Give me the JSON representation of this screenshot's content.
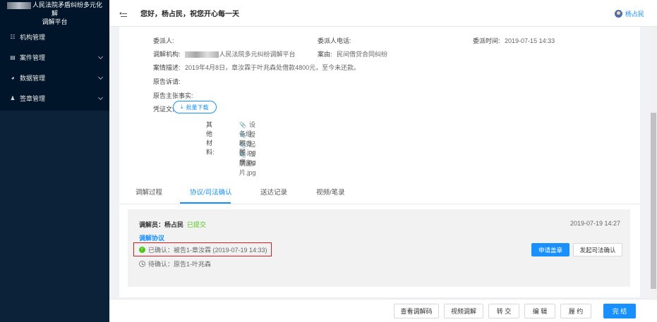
{
  "brand": {
    "title_line1": "人民法院矛盾纠纷多元化解",
    "title_line2": "调解平台"
  },
  "sidebar": {
    "items": [
      {
        "label": "机构管理",
        "icon": "sitemap-icon",
        "expandable": false
      },
      {
        "label": "案件管理",
        "icon": "document-icon",
        "expandable": true
      },
      {
        "label": "数据管理",
        "icon": "pie-chart-icon",
        "expandable": true
      },
      {
        "label": "签章管理",
        "icon": "user-icon",
        "expandable": true
      }
    ]
  },
  "header": {
    "greeting": "您好，杨占民，祝您开心每一天",
    "username": "杨占民"
  },
  "case": {
    "client_label": "委派人:",
    "client_phone_label": "委派人电话:",
    "assign_time_label": "委派时间:",
    "assign_time": "2019-07-15 14:33",
    "org_label": "调解机构:",
    "org_value": "人民法院多元纠纷调解平台",
    "cause_label": "案由:",
    "cause_value": "民间借贷合同纠纷",
    "desc_label": "案情描述:",
    "desc_value": "2019年4月8日，章汝霖于叶兆森处借款4800元，至今未还款。",
    "plaintiff_claim_label": "原告诉请:",
    "plaintiff_facts_label": "原告主张事实:",
    "evidence_label": "凭证文件:",
    "batch_download": "批量下载",
    "other_materials_label": "其他材料:",
    "files": [
      "设备组网图.jpg",
      "授权委托书.jpg",
      "起诉状.zip",
      "法院图片.jpg"
    ]
  },
  "tabs": [
    {
      "label": "调解过程",
      "active": false
    },
    {
      "label": "协议/司法确认",
      "active": true
    },
    {
      "label": "送达记录",
      "active": false
    },
    {
      "label": "视频/笔录",
      "active": false
    }
  ],
  "agreement": {
    "mediator": "调解员：杨占民",
    "status": "已提交",
    "time": "2019-07-19 14:27",
    "title": "调解协议",
    "confirmed": "已确认：被告1-章汝霖 (2019-07-19 14:33)",
    "pending": "待确认：原告1-叶兆森",
    "apply_seal": "申请盖章",
    "judicial_confirm": "发起司法确认"
  },
  "footer": {
    "buttons": [
      {
        "label": "查看调解码",
        "primary": false
      },
      {
        "label": "视频调解",
        "primary": false
      },
      {
        "label": "转 交",
        "primary": false
      },
      {
        "label": "编 辑",
        "primary": false
      },
      {
        "label": "履 约",
        "primary": false
      },
      {
        "label": "完 结",
        "primary": true
      }
    ]
  },
  "colors": {
    "accent": "#1890ff",
    "sidebar_bg": "#001529",
    "success": "#52c41a",
    "highlight_box": "#e0191f"
  }
}
